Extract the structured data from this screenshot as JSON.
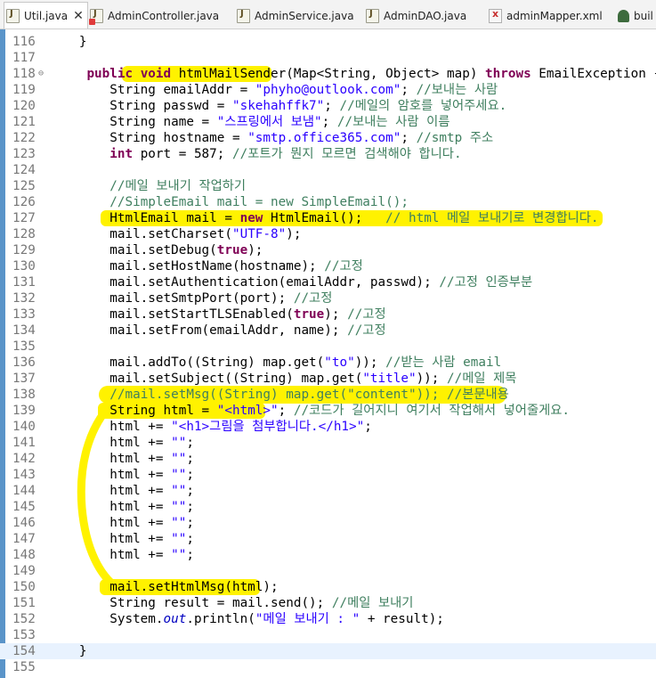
{
  "tabs": [
    {
      "label": "Util.java",
      "icon": "java-file-icon",
      "close": "✕"
    },
    {
      "label": "AdminController.java",
      "icon": "java-file-error-icon"
    },
    {
      "label": "AdminService.java",
      "icon": "java-file-icon"
    },
    {
      "label": "AdminDAO.java",
      "icon": "java-file-icon"
    },
    {
      "label": "adminMapper.xml",
      "icon": "xml-file-icon"
    },
    {
      "label": "buil",
      "icon": "build-file-icon"
    }
  ],
  "highlight_color": "#fff200",
  "lines": [
    {
      "n": "116",
      "code": "   }"
    },
    {
      "n": "117",
      "code": ""
    },
    {
      "n": "118",
      "code": "    public void htmlMailSender(Map<String, Object> map) throws EmailException {"
    },
    {
      "n": "119",
      "code": "       String emailAddr = \"phyho@outlook.com\"; //보내는 사람"
    },
    {
      "n": "120",
      "code": "       String passwd = \"skehahffk7\"; //메일의 암호를 넣어주세요."
    },
    {
      "n": "121",
      "code": "       String name = \"스프링에서 보냄\"; //보내는 사람 이름"
    },
    {
      "n": "122",
      "code": "       String hostname = \"smtp.office365.com\"; //smtp 주소"
    },
    {
      "n": "123",
      "code": "       int port = 587; //포트가 뭔지 모르면 검색해야 합니다."
    },
    {
      "n": "124",
      "code": ""
    },
    {
      "n": "125",
      "code": "       //메일 보내기 작업하기"
    },
    {
      "n": "126",
      "code": "       //SimpleEmail mail = new SimpleEmail();"
    },
    {
      "n": "127",
      "code": "       HtmlEmail mail = new HtmlEmail();   // html 메일 보내기로 변경합니다."
    },
    {
      "n": "128",
      "code": "       mail.setCharset(\"UTF-8\");"
    },
    {
      "n": "129",
      "code": "       mail.setDebug(true);"
    },
    {
      "n": "130",
      "code": "       mail.setHostName(hostname); //고정"
    },
    {
      "n": "131",
      "code": "       mail.setAuthentication(emailAddr, passwd); //고정 인증부분"
    },
    {
      "n": "132",
      "code": "       mail.setSmtpPort(port); //고정"
    },
    {
      "n": "133",
      "code": "       mail.setStartTLSEnabled(true); //고정"
    },
    {
      "n": "134",
      "code": "       mail.setFrom(emailAddr, name); //고정"
    },
    {
      "n": "135",
      "code": ""
    },
    {
      "n": "136",
      "code": "       mail.addTo((String) map.get(\"to\")); //받는 사람 email"
    },
    {
      "n": "137",
      "code": "       mail.setSubject((String) map.get(\"title\")); //메일 제목"
    },
    {
      "n": "138",
      "code": "       //mail.setMsg((String) map.get(\"content\")); //본문내용"
    },
    {
      "n": "139",
      "code": "       String html = \"<html>\"; //코드가 길어지니 여기서 작업해서 넣어줄게요."
    },
    {
      "n": "140",
      "code": "       html += \"<h1>그림을 첨부합니다.</h1>\";"
    },
    {
      "n": "141",
      "code": "       html += \"\";"
    },
    {
      "n": "142",
      "code": "       html += \"\";"
    },
    {
      "n": "143",
      "code": "       html += \"\";"
    },
    {
      "n": "144",
      "code": "       html += \"\";"
    },
    {
      "n": "145",
      "code": "       html += \"\";"
    },
    {
      "n": "146",
      "code": "       html += \"\";"
    },
    {
      "n": "147",
      "code": "       html += \"\";"
    },
    {
      "n": "148",
      "code": "       html += \"\";"
    },
    {
      "n": "149",
      "code": ""
    },
    {
      "n": "150",
      "code": "       mail.setHtmlMsg(html);"
    },
    {
      "n": "151",
      "code": "       String result = mail.send(); //메일 보내기"
    },
    {
      "n": "152",
      "code": "       System.out.println(\"메일 보내기 : \" + result);"
    },
    {
      "n": "153",
      "code": ""
    },
    {
      "n": "154",
      "code": "   }"
    },
    {
      "n": "155",
      "code": ""
    }
  ]
}
